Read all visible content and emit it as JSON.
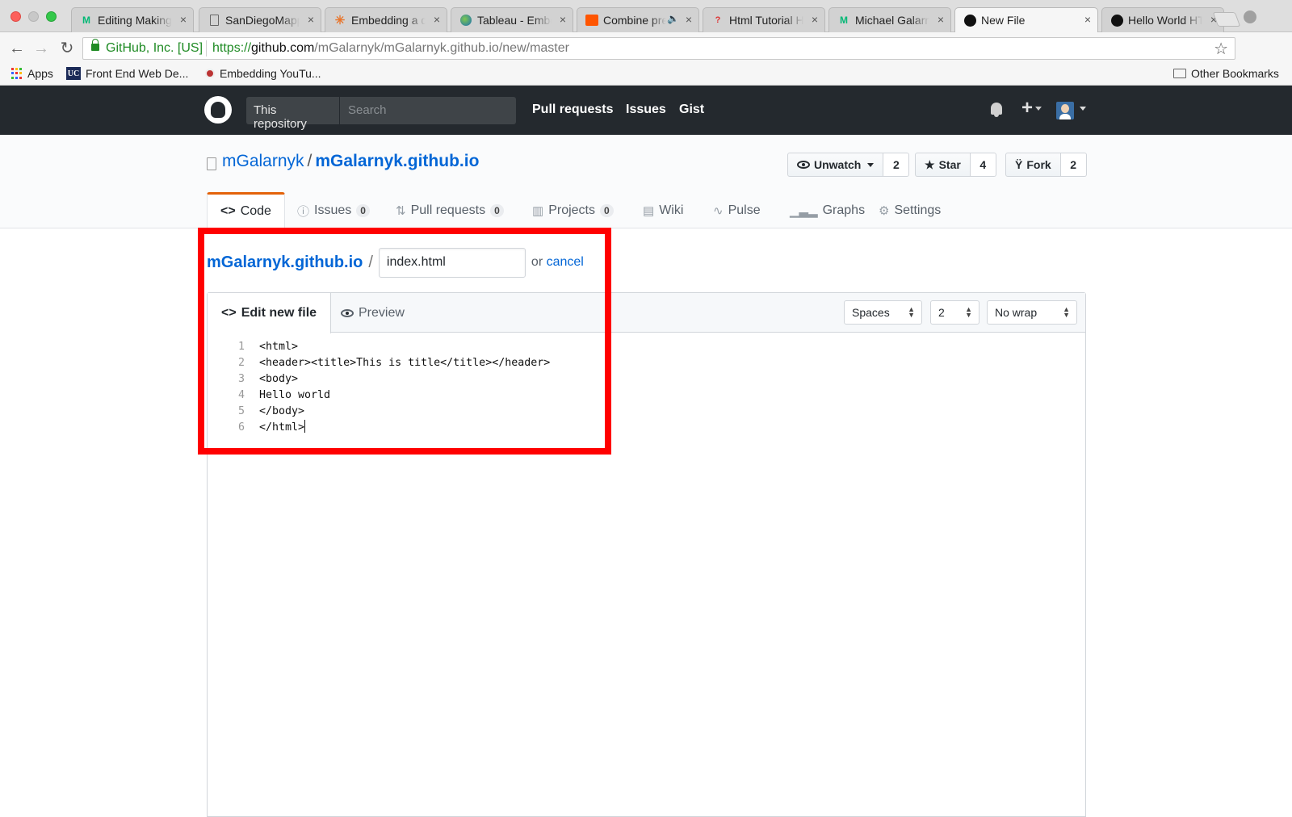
{
  "browser": {
    "tabs": [
      {
        "title": "Editing Making",
        "icon": "medium-icon"
      },
      {
        "title": "SanDiegoMapp",
        "icon": "document-icon"
      },
      {
        "title": "Embedding a da",
        "icon": "tableau-icon"
      },
      {
        "title": "Tableau - Embe",
        "icon": "globe-icon"
      },
      {
        "title": "Combine pre",
        "icon": "soundcloud-icon"
      },
      {
        "title": "Html Tutorial He",
        "icon": "broken-page-icon"
      },
      {
        "title": "Michael Galarny",
        "icon": "medium-icon"
      },
      {
        "title": "New File",
        "icon": "github-icon",
        "active": true
      },
      {
        "title": "Hello World HTM",
        "icon": "github-icon"
      }
    ],
    "security_label": "GitHub, Inc. [US]",
    "url_scheme": "https://",
    "url_host": "github.com",
    "url_path": "/mGalarnyk/mGalarnyk.github.io/new/master",
    "bookmarks": {
      "apps": "Apps",
      "front_end": "Front End Web De...",
      "embedding": "Embedding YouTu...",
      "other": "Other Bookmarks"
    }
  },
  "github_header": {
    "search_scope": "This repository",
    "search_placeholder": "Search",
    "nav": [
      "Pull requests",
      "Issues",
      "Gist"
    ]
  },
  "repo": {
    "owner": "mGalarnyk",
    "name": "mGalarnyk.github.io",
    "watch_label": "Unwatch",
    "watch_count": "2",
    "star_label": "Star",
    "star_count": "4",
    "fork_label": "Fork",
    "fork_count": "2",
    "tabs": {
      "code": "Code",
      "issues": "Issues",
      "issues_count": "0",
      "pulls": "Pull requests",
      "pulls_count": "0",
      "projects": "Projects",
      "projects_count": "0",
      "wiki": "Wiki",
      "pulse": "Pulse",
      "graphs": "Graphs",
      "settings": "Settings"
    }
  },
  "editor": {
    "path_root": "mGalarnyk.github.io",
    "path_sep": "/",
    "filename": "index.html",
    "or_text": "or",
    "cancel": "cancel",
    "tab_edit": "Edit new file",
    "tab_preview": "Preview",
    "indent_mode": "Spaces",
    "indent_size": "2",
    "wrap_mode": "No wrap",
    "lines": [
      {
        "n": "1",
        "text": "<html>"
      },
      {
        "n": "2",
        "text": "<header><title>This is title</title></header>"
      },
      {
        "n": "3",
        "text": "<body>"
      },
      {
        "n": "4",
        "text": "Hello world"
      },
      {
        "n": "5",
        "text": "</body>"
      },
      {
        "n": "6",
        "text": "</html>"
      }
    ]
  },
  "colors": {
    "highlight_box": "#ff0000",
    "link": "#0366d6",
    "header_bg": "#24292e",
    "selected_tab_accent": "#e36209"
  }
}
